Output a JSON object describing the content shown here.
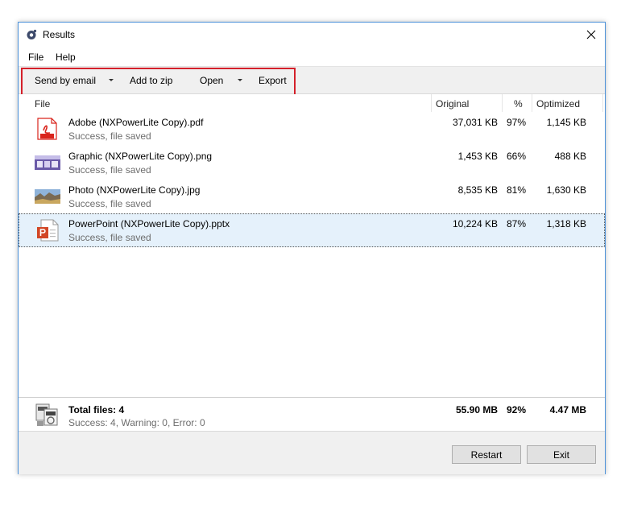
{
  "window": {
    "title": "Results"
  },
  "menu": {
    "items": [
      "File",
      "Help"
    ]
  },
  "toolbar": {
    "send_by_email": "Send by email",
    "add_to_zip": "Add to zip",
    "open": "Open",
    "export": "Export"
  },
  "columns": {
    "file": "File",
    "original": "Original",
    "percent": "%",
    "optimized": "Optimized"
  },
  "files": [
    {
      "name": "Adobe (NXPowerLite Copy).pdf",
      "status": "Success, file saved",
      "original": "37,031 KB",
      "percent": "97%",
      "optimized": "1,145 KB",
      "icon": "pdf-file-icon"
    },
    {
      "name": "Graphic (NXPowerLite Copy).png",
      "status": "Success, file saved",
      "original": "1,453 KB",
      "percent": "66%",
      "optimized": "488 KB",
      "icon": "png-thumbnail-icon"
    },
    {
      "name": "Photo (NXPowerLite Copy).jpg",
      "status": "Success, file saved",
      "original": "8,535 KB",
      "percent": "81%",
      "optimized": "1,630 KB",
      "icon": "jpg-thumbnail-icon"
    },
    {
      "name": "PowerPoint (NXPowerLite Copy).pptx",
      "status": "Success, file saved",
      "original": "10,224 KB",
      "percent": "87%",
      "optimized": "1,318 KB",
      "icon": "pptx-file-icon",
      "selected": true
    }
  ],
  "totals": {
    "label": "Total files: 4",
    "summary": "Success: 4, Warning: 0, Error: 0",
    "original": "55.90 MB",
    "percent": "92%",
    "optimized": "4.47 MB"
  },
  "buttons": {
    "restart": "Restart",
    "exit": "Exit"
  },
  "colors": {
    "accent_border": "#4a90d9",
    "highlight": "#d4202a",
    "selected_row": "#e5f1fb",
    "pdf_red": "#d9241c",
    "ppt_orange": "#d24726"
  }
}
